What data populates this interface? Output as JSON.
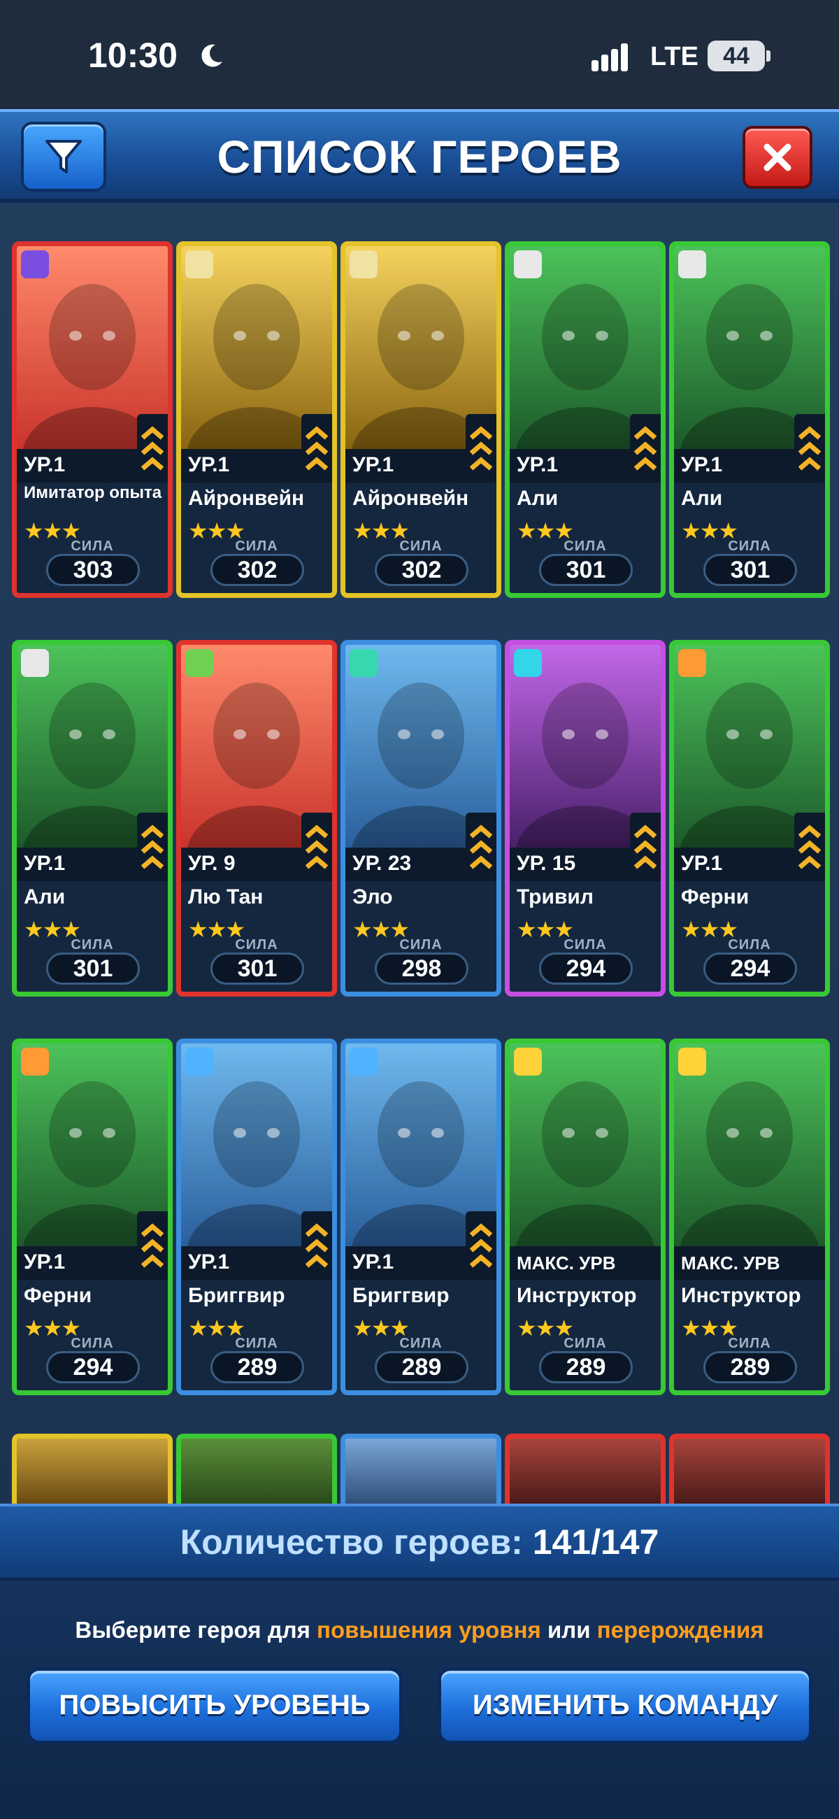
{
  "status": {
    "time": "10:30",
    "network": "LTE",
    "battery": "44"
  },
  "header": {
    "title": "СПИСОК ГЕРОЕВ"
  },
  "labels": {
    "power": "СИЛА"
  },
  "heroes": [
    {
      "name": "Имитатор опыта",
      "level": "УР.1",
      "stars": "★★★",
      "power": "303",
      "rarity": "red",
      "badge": "experience-icon"
    },
    {
      "name": "Айронвейн",
      "level": "УР.1",
      "stars": "★★★",
      "power": "302",
      "rarity": "gold",
      "badge": "holy-icon"
    },
    {
      "name": "Айронвейн",
      "level": "УР.1",
      "stars": "★★★",
      "power": "302",
      "rarity": "gold",
      "badge": "holy-icon"
    },
    {
      "name": "Али",
      "level": "УР.1",
      "stars": "★★★",
      "power": "301",
      "rarity": "green",
      "badge": "lotus-icon"
    },
    {
      "name": "Али",
      "level": "УР.1",
      "stars": "★★★",
      "power": "301",
      "rarity": "green",
      "badge": "lotus-icon"
    },
    {
      "name": "Али",
      "level": "УР.1",
      "stars": "★★★",
      "power": "301",
      "rarity": "green",
      "badge": "lotus-icon"
    },
    {
      "name": "Лю Тан",
      "level": "УР. 9",
      "stars": "★★★",
      "power": "301",
      "rarity": "red",
      "badge": "nature-icon"
    },
    {
      "name": "Эло",
      "level": "УР. 23",
      "stars": "★★★",
      "power": "298",
      "rarity": "blue",
      "badge": "crystal-icon"
    },
    {
      "name": "Тривил",
      "level": "УР. 15",
      "stars": "★★★",
      "power": "294",
      "rarity": "purple",
      "badge": "pi-icon"
    },
    {
      "name": "Ферни",
      "level": "УР.1",
      "stars": "★★★",
      "power": "294",
      "rarity": "green",
      "badge": "tiger-icon"
    },
    {
      "name": "Ферни",
      "level": "УР.1",
      "stars": "★★★",
      "power": "294",
      "rarity": "green",
      "badge": "tiger-icon"
    },
    {
      "name": "Бриггвир",
      "level": "УР.1",
      "stars": "★★★",
      "power": "289",
      "rarity": "blue",
      "badge": "bull-icon"
    },
    {
      "name": "Бриггвир",
      "level": "УР.1",
      "stars": "★★★",
      "power": "289",
      "rarity": "blue",
      "badge": "bull-icon"
    },
    {
      "name": "Инструктор",
      "level": "МАКС. УРВ",
      "stars": "★★★",
      "power": "289",
      "rarity": "green",
      "badge": "xp-plus-icon"
    },
    {
      "name": "Инструктор",
      "level": "МАКС. УРВ",
      "stars": "★★★",
      "power": "289",
      "rarity": "green",
      "badge": "xp-plus-icon"
    }
  ],
  "footer": {
    "count_label": "Количество героев:",
    "count_value": "141/147",
    "hint_prefix": "Выберите героя для",
    "hint_levelup": "повышения уровня",
    "hint_or": "или",
    "hint_rebirth": "перерождения",
    "levelup_button": "ПОВЫСИТЬ УРОВЕНЬ",
    "team_button": "ИЗМЕНИТЬ КОМАНДУ"
  },
  "colors": {
    "rarity_green": "#38c934",
    "rarity_red": "#e0332d",
    "rarity_gold": "#e3c327",
    "rarity_blue": "#3c8ee0",
    "rarity_purple": "#c64fe0",
    "highlight_orange": "#ff9d1f"
  }
}
